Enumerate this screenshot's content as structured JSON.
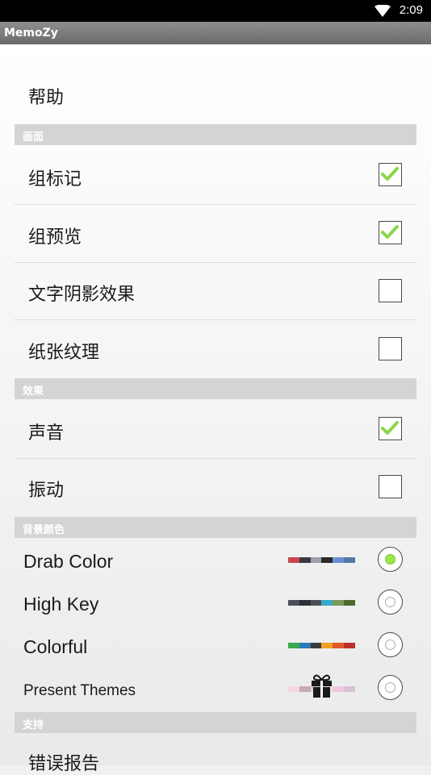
{
  "status_bar": {
    "time": "2:09",
    "wifi_icon": "wifi-icon"
  },
  "app_title": "MemoZy",
  "help_label": "帮助",
  "sections": {
    "display": {
      "header": "画面",
      "items": [
        {
          "label": "组标记",
          "checked": true
        },
        {
          "label": "组预览",
          "checked": true
        },
        {
          "label": "文字阴影效果",
          "checked": false
        },
        {
          "label": "纸张纹理",
          "checked": false
        }
      ]
    },
    "effects": {
      "header": "效果",
      "items": [
        {
          "label": "声音",
          "checked": true
        },
        {
          "label": "振动",
          "checked": false
        }
      ]
    },
    "background": {
      "header": "背景颜色",
      "themes": [
        {
          "label": "Drab Color",
          "selected": true,
          "colors": [
            "#c8484e",
            "#3a3a3a",
            "#9aa0aa",
            "#2a2a2a",
            "#6b8fd0",
            "#5576a8"
          ]
        },
        {
          "label": "High Key",
          "selected": false,
          "colors": [
            "#4b4f58",
            "#2d3138",
            "#4b4f58",
            "#3aa9c8",
            "#7a9a5a",
            "#4f6a2e"
          ]
        },
        {
          "label": "Colorful",
          "selected": false,
          "colors": [
            "#3aa84a",
            "#2a7ab8",
            "#3a3a3a",
            "#f0a020",
            "#e05a28",
            "#c0302a"
          ]
        },
        {
          "label": "Present Themes",
          "selected": false,
          "colors": [
            "#f3d8e0",
            "#c8a8b8",
            "#d8d8d8",
            "#e8e0f0",
            "#f0c8dc",
            "#d8c0d8"
          ],
          "gift_icon": "gift-icon"
        }
      ]
    },
    "support": {
      "header": "支持",
      "items": [
        {
          "label": "错误报告"
        }
      ]
    }
  },
  "colors": {
    "check": "#8ad64a",
    "radio_selected": "#9be74a"
  }
}
